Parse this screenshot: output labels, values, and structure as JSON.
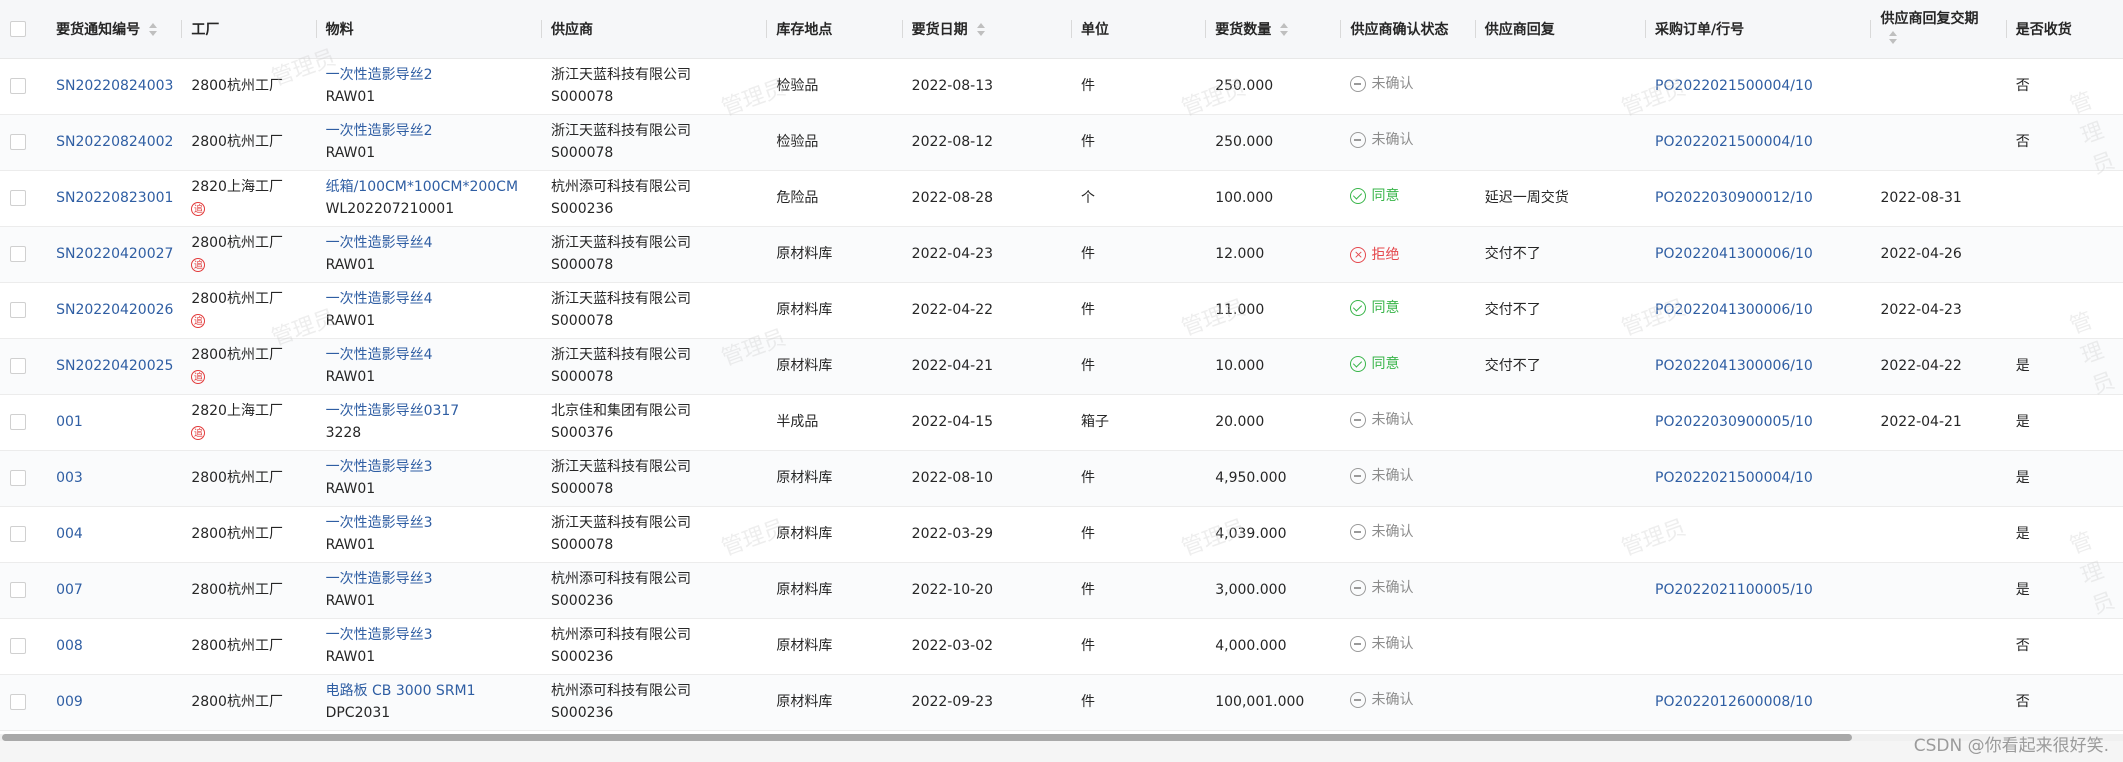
{
  "table": {
    "headers": {
      "select": "",
      "notice_no": "要货通知编号",
      "plant": "工厂",
      "material": "物料",
      "supplier": "供应商",
      "storage": "库存地点",
      "date": "要货日期",
      "unit": "单位",
      "quantity": "要货数量",
      "confirm_status": "供应商确认状态",
      "reply": "供应商回复",
      "po_line": "采购订单/行号",
      "reply_date": "供应商回复交期",
      "received": "是否收货"
    },
    "rows": [
      {
        "notice_no": "SN20220824003",
        "plant": "2800杭州工厂",
        "material_name": "一次性造影导丝2",
        "material_code": "RAW01",
        "supplier_name": "浙江天蓝科技有限公司",
        "supplier_code": "S000078",
        "storage": "检验品",
        "date": "2022-08-13",
        "unit": "件",
        "quantity": "250.000",
        "status": "未确认",
        "status_icon": "minus-circle-icon",
        "reply": "",
        "po": "PO2022021500004/10",
        "reply_date": "",
        "received": "否"
      },
      {
        "notice_no": "SN20220824002",
        "plant": "2800杭州工厂",
        "material_name": "一次性造影导丝2",
        "material_code": "RAW01",
        "supplier_name": "浙江天蓝科技有限公司",
        "supplier_code": "S000078",
        "storage": "检验品",
        "date": "2022-08-12",
        "unit": "件",
        "quantity": "250.000",
        "status": "未确认",
        "status_icon": "minus-circle-icon",
        "reply": "",
        "po": "PO2022021500004/10",
        "reply_date": "",
        "received": "否"
      },
      {
        "notice_no": "SN20220823001",
        "plant": "2820上海工厂",
        "material_name": "纸箱/100CM*100CM*200CM",
        "material_code": "WL202207210001",
        "supplier_name": "杭州添可科技有限公司",
        "supplier_code": "S000236",
        "storage": "危险品",
        "date": "2022-08-28",
        "unit": "个",
        "quantity": "100.000",
        "status": "同意",
        "status_icon": "check-circle-icon",
        "reply": "延迟一周交货",
        "po": "PO2022030900012/10",
        "reply_date": "2022-08-31",
        "received": ""
      },
      {
        "notice_no": "SN20220420027",
        "plant": "2800杭州工厂",
        "material_name": "一次性造影导丝4",
        "material_code": "RAW01",
        "supplier_name": "浙江天蓝科技有限公司",
        "supplier_code": "S000078",
        "storage": "原材料库",
        "date": "2022-04-23",
        "unit": "件",
        "quantity": "12.000",
        "status": "拒绝",
        "status_icon": "x-circle-icon",
        "reply": "交付不了",
        "po": "PO2022041300006/10",
        "reply_date": "2022-04-26",
        "received": ""
      },
      {
        "notice_no": "SN20220420026",
        "plant": "2800杭州工厂",
        "material_name": "一次性造影导丝4",
        "material_code": "RAW01",
        "supplier_name": "浙江天蓝科技有限公司",
        "supplier_code": "S000078",
        "storage": "原材料库",
        "date": "2022-04-22",
        "unit": "件",
        "quantity": "11.000",
        "status": "同意",
        "status_icon": "check-circle-icon",
        "reply": "交付不了",
        "po": "PO2022041300006/10",
        "reply_date": "2022-04-23",
        "received": ""
      },
      {
        "notice_no": "SN20220420025",
        "plant": "2800杭州工厂",
        "material_name": "一次性造影导丝4",
        "material_code": "RAW01",
        "supplier_name": "浙江天蓝科技有限公司",
        "supplier_code": "S000078",
        "storage": "原材料库",
        "date": "2022-04-21",
        "unit": "件",
        "quantity": "10.000",
        "status": "同意",
        "status_icon": "check-circle-icon",
        "reply": "交付不了",
        "po": "PO2022041300006/10",
        "reply_date": "2022-04-22",
        "received": "是"
      },
      {
        "notice_no": "001",
        "plant": "2820上海工厂",
        "material_name": "一次性造影导丝0317",
        "material_code": "3228",
        "supplier_name": "北京佳和集团有限公司",
        "supplier_code": "S000376",
        "storage": "半成品",
        "date": "2022-04-15",
        "unit": "箱子",
        "quantity": "20.000",
        "status": "未确认",
        "status_icon": "minus-circle-icon",
        "reply": "",
        "po": "PO2022030900005/10",
        "reply_date": "2022-04-21",
        "received": "是"
      },
      {
        "notice_no": "003",
        "plant": "2800杭州工厂",
        "material_name": "一次性造影导丝3",
        "material_code": "RAW01",
        "supplier_name": "浙江天蓝科技有限公司",
        "supplier_code": "S000078",
        "storage": "原材料库",
        "date": "2022-08-10",
        "unit": "件",
        "quantity": "4,950.000",
        "status": "未确认",
        "status_icon": "minus-circle-icon",
        "reply": "",
        "po": "PO2022021500004/10",
        "reply_date": "",
        "received": "是"
      },
      {
        "notice_no": "004",
        "plant": "2800杭州工厂",
        "material_name": "一次性造影导丝3",
        "material_code": "RAW01",
        "supplier_name": "浙江天蓝科技有限公司",
        "supplier_code": "S000078",
        "storage": "原材料库",
        "date": "2022-03-29",
        "unit": "件",
        "quantity": "4,039.000",
        "status": "未确认",
        "status_icon": "minus-circle-icon",
        "reply": "",
        "po": "",
        "reply_date": "",
        "received": "是"
      },
      {
        "notice_no": "007",
        "plant": "2800杭州工厂",
        "material_name": "一次性造影导丝3",
        "material_code": "RAW01",
        "supplier_name": "杭州添可科技有限公司",
        "supplier_code": "S000236",
        "storage": "原材料库",
        "date": "2022-10-20",
        "unit": "件",
        "quantity": "3,000.000",
        "status": "未确认",
        "status_icon": "minus-circle-icon",
        "reply": "",
        "po": "PO2022021100005/10",
        "reply_date": "",
        "received": "是"
      },
      {
        "notice_no": "008",
        "plant": "2800杭州工厂",
        "material_name": "一次性造影导丝3",
        "material_code": "RAW01",
        "supplier_name": "杭州添可科技有限公司",
        "supplier_code": "S000236",
        "storage": "原材料库",
        "date": "2022-03-02",
        "unit": "件",
        "quantity": "4,000.000",
        "status": "未确认",
        "status_icon": "minus-circle-icon",
        "reply": "",
        "po": "",
        "reply_date": "",
        "received": "否"
      },
      {
        "notice_no": "009",
        "plant": "2800杭州工厂",
        "material_name": "电路板 CB 3000 SRM1",
        "material_code": "DPC2031",
        "supplier_name": "杭州添可科技有限公司",
        "supplier_code": "S000236",
        "storage": "原材料库",
        "date": "2022-09-23",
        "unit": "件",
        "quantity": "100,001.000",
        "status": "未确认",
        "status_icon": "minus-circle-icon",
        "reply": "",
        "po": "PO2022012600008/10",
        "reply_date": "",
        "received": "否"
      }
    ]
  },
  "dependency_badge": "追",
  "dependency_rows": [
    2,
    3,
    4,
    5,
    6
  ],
  "watermark": "管理员",
  "footer": {
    "credit": "CSDN @你看起来很好笑."
  },
  "colors": {
    "link": "#2f5ea3",
    "ok": "#39b54a",
    "rejected": "#e5484d",
    "pending": "#8c8c8c"
  }
}
